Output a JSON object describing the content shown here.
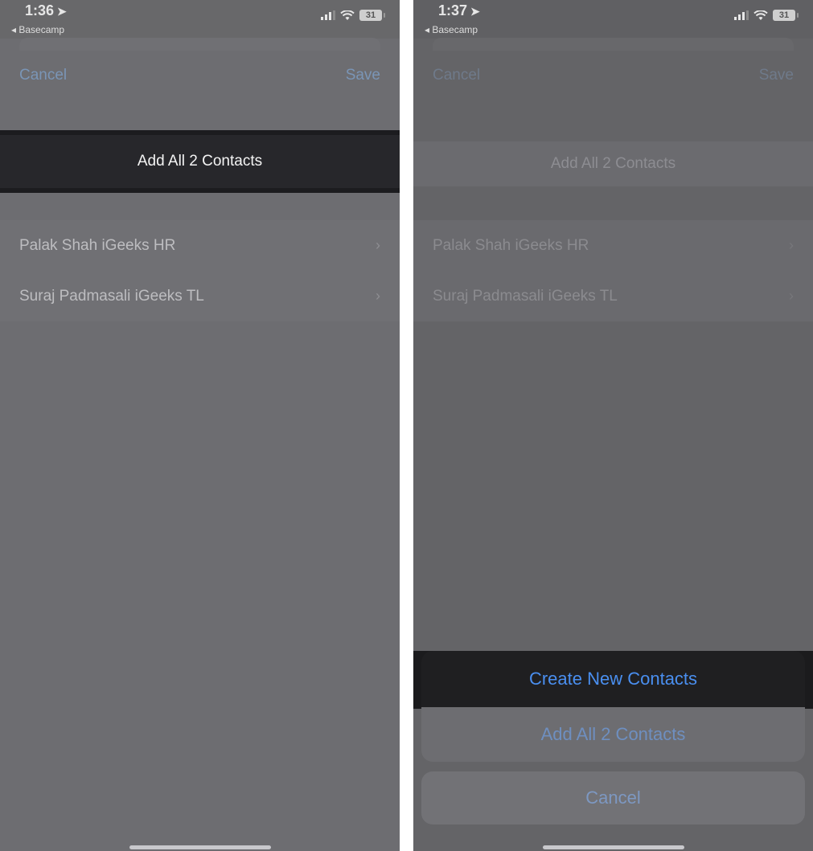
{
  "screens": [
    {
      "status": {
        "time": "1:36",
        "back_app": "Basecamp",
        "battery": "31"
      },
      "nav": {
        "cancel": "Cancel",
        "save": "Save"
      },
      "add_all": "Add All 2 Contacts",
      "contacts": [
        {
          "name": "Palak Shah iGeeks HR"
        },
        {
          "name": "Suraj Padmasali iGeeks TL"
        }
      ]
    },
    {
      "status": {
        "time": "1:37",
        "back_app": "Basecamp",
        "battery": "31"
      },
      "nav": {
        "cancel": "Cancel",
        "save": "Save"
      },
      "add_all": "Add All 2 Contacts",
      "contacts": [
        {
          "name": "Palak Shah iGeeks HR"
        },
        {
          "name": "Suraj Padmasali iGeeks TL"
        }
      ],
      "action_sheet": {
        "create_new": "Create New Contacts",
        "add_all": "Add All 2 Contacts",
        "cancel": "Cancel"
      }
    }
  ],
  "colors": {
    "accent": "#4a8ff0",
    "dim_background": "#6d6d71"
  }
}
